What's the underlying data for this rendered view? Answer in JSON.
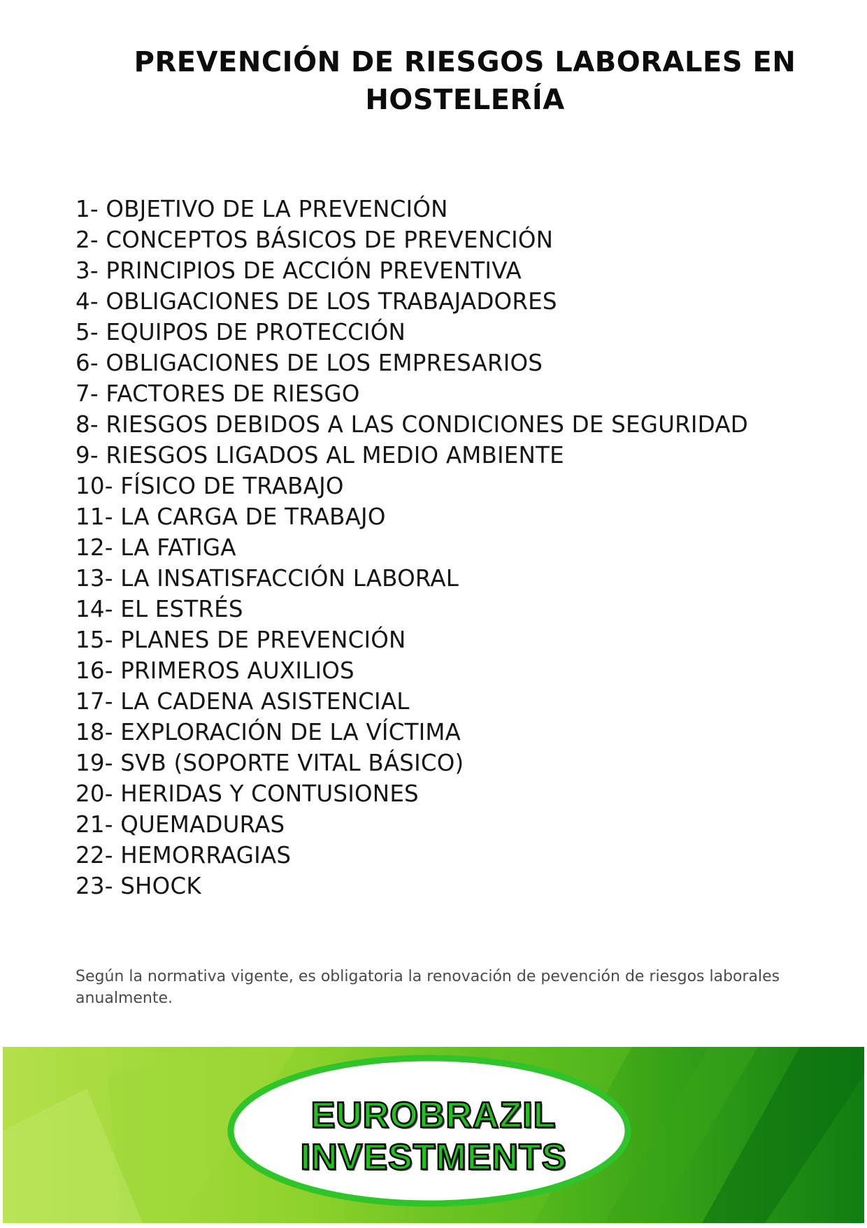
{
  "document": {
    "title_line1": "PREVENCIÓN DE RIESGOS LABORALES  EN",
    "title_line2": "HOSTELERÍA",
    "topics": [
      "1- OBJETIVO DE LA PREVENCIÓN",
      "2- CONCEPTOS BÁSICOS DE PREVENCIÓN",
      "3- PRINCIPIOS DE ACCIÓN PREVENTIVA",
      "4- OBLIGACIONES DE LOS TRABAJADORES",
      "5- EQUIPOS DE PROTECCIÓN",
      "6- OBLIGACIONES DE LOS EMPRESARIOS",
      "7- FACTORES DE RIESGO",
      "8- RIESGOS DEBIDOS A LAS CONDICIONES DE SEGURIDAD",
      "9- RIESGOS LIGADOS AL MEDIO AMBIENTE",
      "10- FÍSICO DE TRABAJO",
      "11- LA CARGA DE TRABAJO",
      "12- LA FATIGA",
      "13- LA INSATISFACCIÓN LABORAL",
      "14- EL ESTRÉS",
      "15- PLANES DE PREVENCIÓN",
      "16- PRIMEROS AUXILIOS",
      "17- LA CADENA ASISTENCIAL",
      "18- EXPLORACIÓN DE LA VÍCTIMA",
      "19- SVB (SOPORTE VITAL BÁSICO)",
      "20- HERIDAS Y CONTUSIONES",
      "21- QUEMADURAS",
      "22- HEMORRAGIAS",
      "23- SHOCK"
    ],
    "note": "Según la normativa vigente, es obligatoria la renovación de pevención de riesgos laborales anualmente."
  },
  "banner": {
    "logo_line1": "EUROBRAZIL",
    "logo_line2": "INVESTMENTS",
    "colors": {
      "light_green": "#a9dd3c",
      "mid_green": "#5fbf1c",
      "dark_green": "#0e7a10",
      "logo_fill": "#22c21e",
      "ellipse_border": "#2fc42a"
    }
  }
}
